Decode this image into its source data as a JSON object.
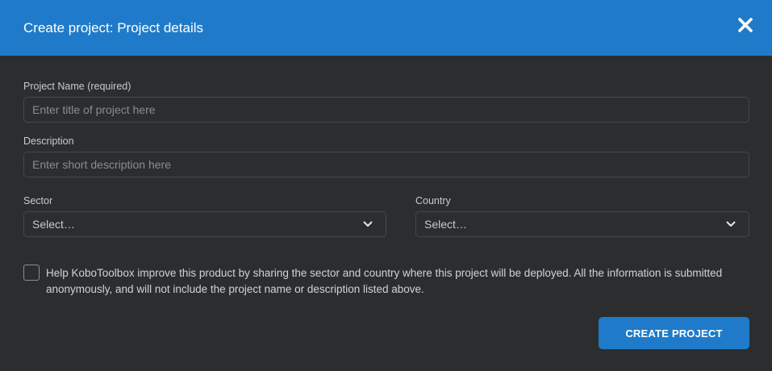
{
  "modal": {
    "title": "Create project: Project details",
    "close_icon": "close-icon"
  },
  "form": {
    "project_name": {
      "label": "Project Name (required)",
      "value": "",
      "placeholder": "Enter title of project here"
    },
    "description": {
      "label": "Description",
      "value": "",
      "placeholder": "Enter short description here"
    },
    "sector": {
      "label": "Sector",
      "selected": "Select…",
      "icon": "chevron-down-icon"
    },
    "country": {
      "label": "Country",
      "selected": "Select…",
      "icon": "chevron-down-icon"
    },
    "share_consent": {
      "checked": false,
      "text": "Help KoboToolbox improve this product by sharing the sector and country where this project will be deployed. All the information is submitted anonymously, and will not include the project name or description listed above."
    },
    "submit_label": "CREATE PROJECT"
  },
  "colors": {
    "header_bg": "#1f7bc9",
    "body_bg": "#2c2d2f",
    "accent": "#1f7bc9",
    "input_border": "#45474b"
  }
}
